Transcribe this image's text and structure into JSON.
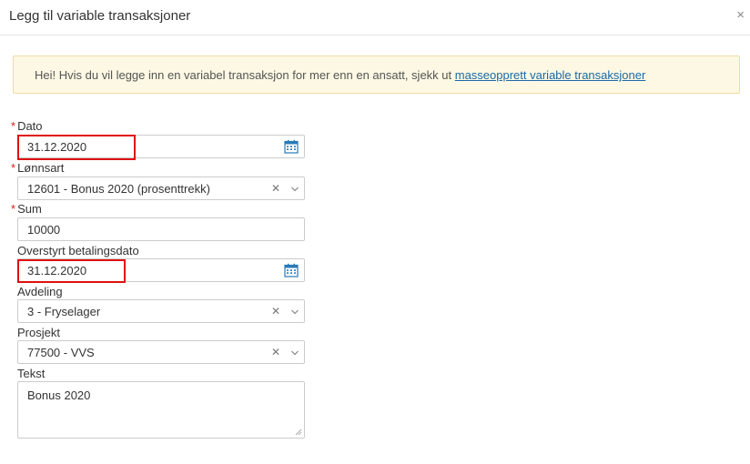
{
  "modal": {
    "title": "Legg til variable transaksjoner",
    "close_icon": "×"
  },
  "alert": {
    "text": "Hei! Hvis du vil legge inn en variabel transaksjon for mer enn en ansatt, sjekk ut ",
    "link": "masseopprett variable transaksjoner"
  },
  "form": {
    "required_marker": "*",
    "dato": {
      "label": "Dato",
      "value": "31.12.2020",
      "icon": "calendar-icon"
    },
    "lonnsart": {
      "label": "Lønnsart",
      "value": "12601 - Bonus 2020 (prosenttrekk)"
    },
    "sum": {
      "label": "Sum",
      "value": "10000"
    },
    "betalingsdato": {
      "label": "Overstyrt betalingsdato",
      "value": "31.12.2020",
      "icon": "calendar-icon"
    },
    "avdeling": {
      "label": "Avdeling",
      "value": "3 - Fryselager"
    },
    "prosjekt": {
      "label": "Prosjekt",
      "value": "77500 - VVS"
    },
    "tekst": {
      "label": "Tekst",
      "value": "Bonus 2020"
    }
  },
  "select_clear_glyph": "✕",
  "colors": {
    "highlight": "#e01010",
    "alert_bg": "#fcf8e3",
    "link": "#1a6aa8",
    "required": "#d02020",
    "calendar": "#2a7ab8"
  }
}
